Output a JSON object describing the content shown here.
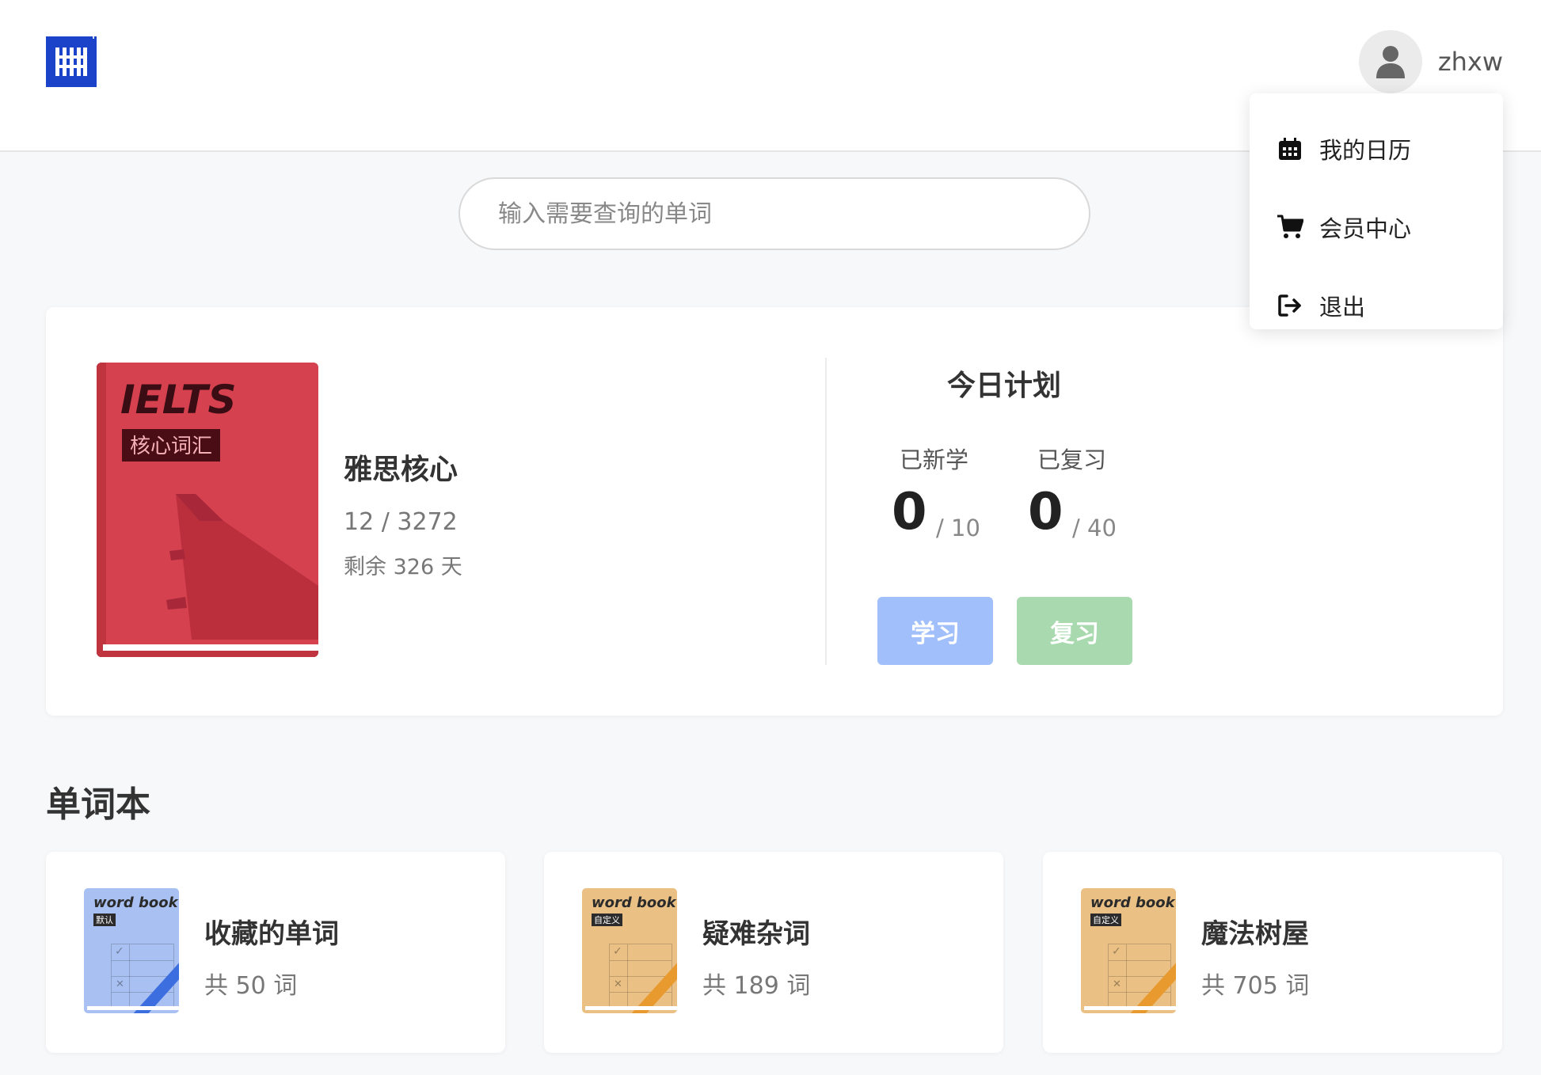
{
  "header": {
    "logo_icon": "app-logo",
    "username": "zhxw",
    "avatar_icon": "user-icon"
  },
  "user_menu": {
    "items": [
      {
        "label": "我的日历",
        "icon": "calendar-icon"
      },
      {
        "label": "会员中心",
        "icon": "cart-icon"
      },
      {
        "label": "退出",
        "icon": "logout-icon"
      }
    ]
  },
  "search": {
    "placeholder": "输入需要查询的单词",
    "value": ""
  },
  "current_book": {
    "cover_title": "IELTS",
    "cover_subtitle": "核心词汇",
    "name": "雅思核心",
    "progress": "12 / 3272",
    "remaining": "剩余 326 天",
    "cover_color": "#d5414f"
  },
  "today_plan": {
    "title": "今日计划",
    "learned": {
      "label": "已新学",
      "value": "0",
      "target": "/ 10"
    },
    "reviewed": {
      "label": "已复习",
      "value": "0",
      "target": "/ 40"
    },
    "learn_button": "学习",
    "review_button": "复习",
    "learn_color": "#a1bffa",
    "review_color": "#a9d9af"
  },
  "wordbooks": {
    "title": "单词本",
    "items": [
      {
        "cover_text": "word book",
        "tag": "默认",
        "name": "收藏的单词",
        "count": "共 50 词",
        "cover_color": "#a9c1f2",
        "stripe_color": "#3d6ee0"
      },
      {
        "cover_text": "word book",
        "tag": "自定义",
        "name": "疑难杂词",
        "count": "共 189 词",
        "cover_color": "#eac084",
        "stripe_color": "#e89a2f"
      },
      {
        "cover_text": "word book",
        "tag": "自定义",
        "name": "魔法树屋",
        "count": "共 705 词",
        "cover_color": "#eac084",
        "stripe_color": "#e89a2f"
      }
    ]
  }
}
